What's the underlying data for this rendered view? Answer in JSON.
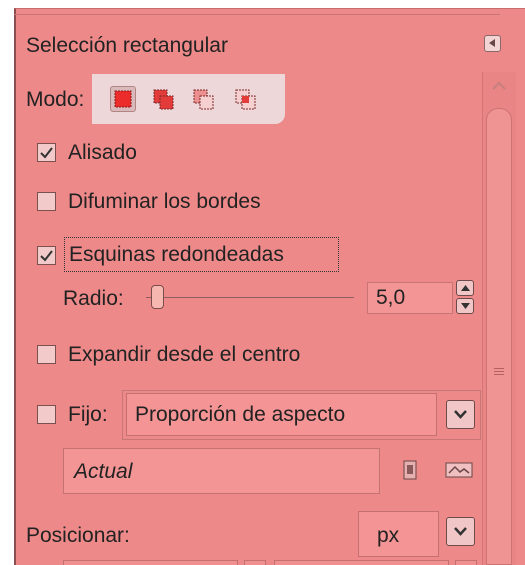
{
  "panel": {
    "title": "Selección rectangular"
  },
  "mode": {
    "label": "Modo:",
    "options": [
      {
        "icon": "replace-selection-icon",
        "active": true
      },
      {
        "icon": "add-selection-icon",
        "active": false
      },
      {
        "icon": "subtract-selection-icon",
        "active": false
      },
      {
        "icon": "intersect-selection-icon",
        "active": false
      }
    ]
  },
  "options": {
    "antialias": {
      "label": "Alisado",
      "checked": true
    },
    "feather": {
      "label": "Difuminar los bordes",
      "checked": false
    },
    "rounded": {
      "label": "Esquinas redondeadas",
      "checked": true
    },
    "expand": {
      "label": "Expandir desde el centro",
      "checked": false
    },
    "fixed": {
      "label": "Fijo:",
      "checked": false
    }
  },
  "radius": {
    "label": "Radio:",
    "value": "5,0"
  },
  "fixed_mode": {
    "selected": "Proporción de aspecto"
  },
  "aspect": {
    "value": "Actual"
  },
  "position": {
    "label": "Posicionar:",
    "unit": "px"
  },
  "colors": {
    "panel_background": "#ee8989",
    "field_background": "#f49494",
    "mode_box": "#edd7d8"
  }
}
